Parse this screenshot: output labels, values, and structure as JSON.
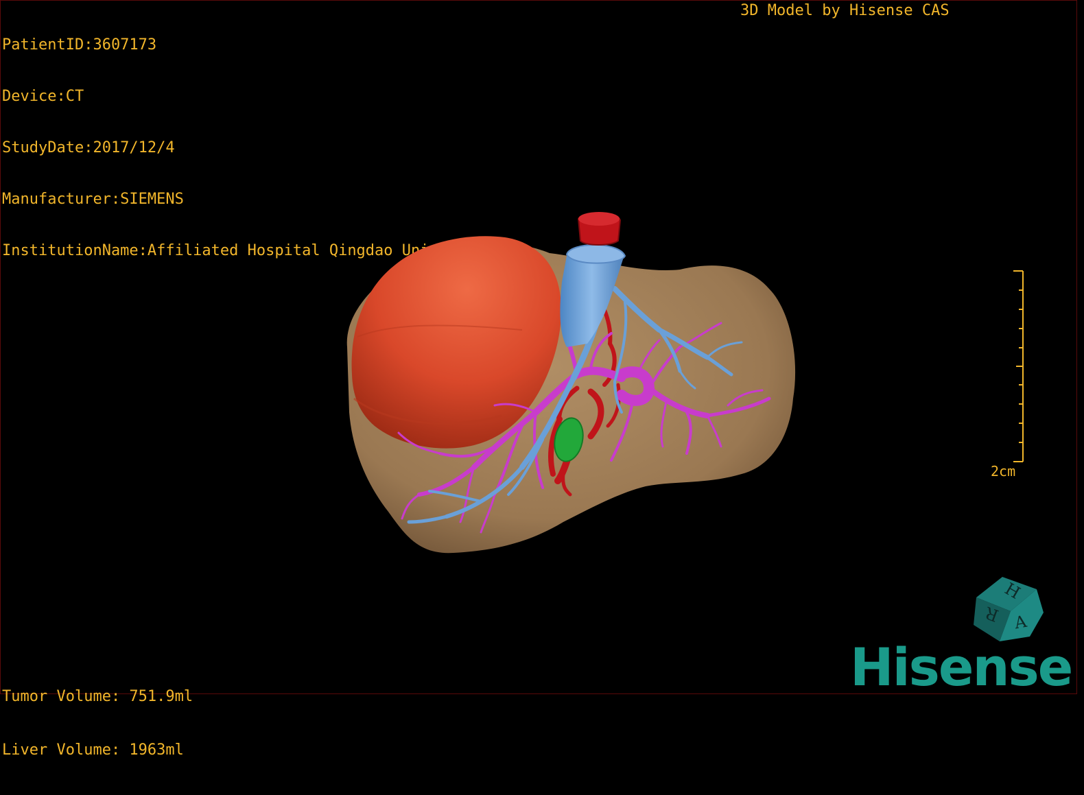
{
  "header": {
    "patient_id": "PatientID:3607173",
    "device": "Device:CT",
    "study_date": "StudyDate:2017/12/4",
    "manufacturer": "Manufacturer:SIEMENS",
    "institution": "InstitutionName:Affiliated Hospital Qingdao University-C"
  },
  "credit": "3D Model by Hisense CAS",
  "volumes": {
    "tumor": "Tumor Volume: 751.9ml",
    "liver": "Liver Volume: 1963ml"
  },
  "scale": {
    "label": "2cm"
  },
  "orientation_cube": {
    "faces": [
      "H",
      "R",
      "A"
    ]
  },
  "brand": {
    "name": "Hisense",
    "color": "#1a9a8a"
  },
  "colors": {
    "text": "#f2b62b",
    "liver": "#9c7a55",
    "tumor": "#d9482a",
    "vena_cava": "#6aa0d8",
    "portal_vein": "#c83ccc",
    "artery": "#c0141a",
    "gallbladder": "#22a83a",
    "background": "#000000"
  },
  "icons": {
    "cube": "orientation-cube-icon",
    "scalebar": "scale-bar-icon"
  }
}
